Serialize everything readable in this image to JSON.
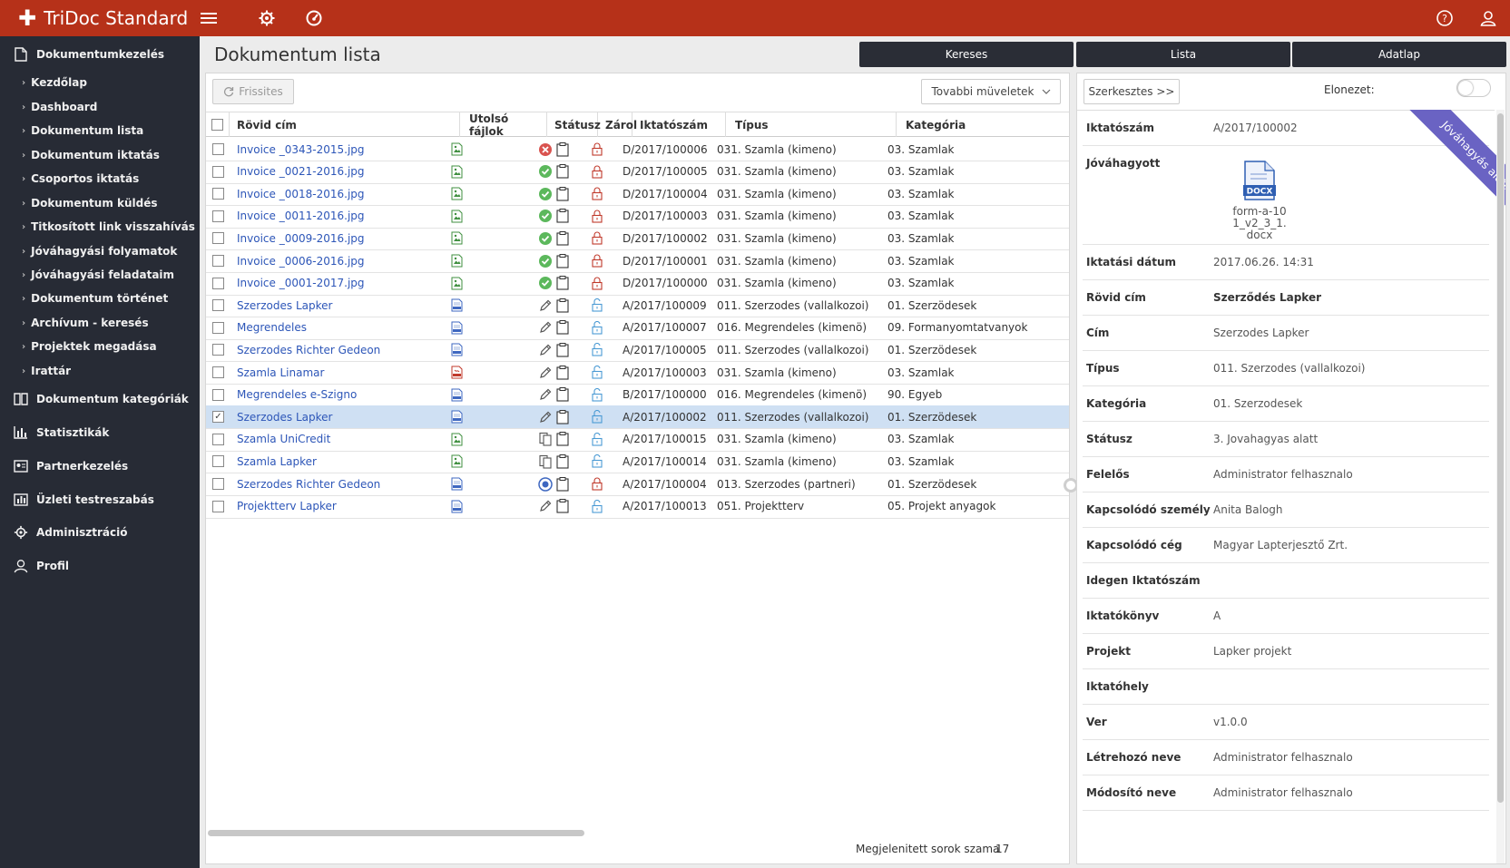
{
  "app": {
    "title": "TriDoc Standard"
  },
  "sidebar": {
    "sections": [
      {
        "label": "Dokumentumkezelés",
        "icon": "document-icon"
      },
      {
        "label": "Dokumentum kategóriák",
        "icon": "book-icon"
      },
      {
        "label": "Statisztikák",
        "icon": "bar-chart-icon"
      },
      {
        "label": "Partnerkezelés",
        "icon": "contact-card-icon"
      },
      {
        "label": "Üzleti testreszabás",
        "icon": "chart-settings-icon"
      },
      {
        "label": "Adminisztráció",
        "icon": "gear-icon"
      },
      {
        "label": "Profil",
        "icon": "user-icon"
      }
    ],
    "items": [
      "Kezdőlap",
      "Dashboard",
      "Dokumentum lista",
      "Dokumentum iktatás",
      "Csoportos iktatás",
      "Dokumentum küldés",
      "Titkosított link visszahívás",
      "Jóváhagyási folyamatok",
      "Jóváhagyási feladataim",
      "Dokumentum történet",
      "Archívum - keresés",
      "Projektek megadása",
      "Irattár"
    ]
  },
  "page": {
    "title": "Dokumentum lista"
  },
  "tabs": {
    "search": "Kereses",
    "list": "Lista",
    "datasheet": "Adatlap"
  },
  "toolbar": {
    "refresh": "Frissites",
    "more": "Tovabbi müveletek"
  },
  "table": {
    "headers": {
      "short_title": "Rövid cím",
      "last_files": "Utolsó fájlok",
      "status": "Státusz",
      "lock": "Zárol",
      "reg_no": "Iktatószám",
      "type": "Típus",
      "category": "Kategória"
    },
    "rows": [
      {
        "title": "Invoice _0343-2015.jpg",
        "file": "image",
        "status": "rejected",
        "locked": true,
        "reg_no": "D/2017/100006",
        "type": "031. Szamla (kimeno)",
        "category": "03. Szamlak",
        "checked": false
      },
      {
        "title": "Invoice _0021-2016.jpg",
        "file": "image",
        "status": "approved",
        "locked": true,
        "reg_no": "D/2017/100005",
        "type": "031. Szamla (kimeno)",
        "category": "03. Szamlak",
        "checked": false
      },
      {
        "title": "Invoice _0018-2016.jpg",
        "file": "image",
        "status": "approved",
        "locked": true,
        "reg_no": "D/2017/100004",
        "type": "031. Szamla (kimeno)",
        "category": "03. Szamlak",
        "checked": false
      },
      {
        "title": "Invoice _0011-2016.jpg",
        "file": "image",
        "status": "approved",
        "locked": true,
        "reg_no": "D/2017/100003",
        "type": "031. Szamla (kimeno)",
        "category": "03. Szamlak",
        "checked": false
      },
      {
        "title": "Invoice _0009-2016.jpg",
        "file": "image",
        "status": "approved",
        "locked": true,
        "reg_no": "D/2017/100002",
        "type": "031. Szamla (kimeno)",
        "category": "03. Szamlak",
        "checked": false
      },
      {
        "title": "Invoice _0006-2016.jpg",
        "file": "image",
        "status": "approved",
        "locked": true,
        "reg_no": "D/2017/100001",
        "type": "031. Szamla (kimeno)",
        "category": "03. Szamlak",
        "checked": false
      },
      {
        "title": "Invoice _0001-2017.jpg",
        "file": "image",
        "status": "approved",
        "locked": true,
        "reg_no": "D/2017/100000",
        "type": "031. Szamla (kimeno)",
        "category": "03. Szamlak",
        "checked": false
      },
      {
        "title": "Szerzodes Lapker",
        "file": "doc",
        "status": "edit",
        "locked": false,
        "reg_no": "A/2017/100009",
        "type": "011. Szerzodes (vallalkozoi)",
        "category": "01. Szerzödesek",
        "checked": false
      },
      {
        "title": "Megrendeles",
        "file": "doc",
        "status": "edit",
        "locked": false,
        "reg_no": "A/2017/100007",
        "type": "016. Megrendeles (kimenö)",
        "category": "09. Formanyomtatvanyok",
        "checked": false
      },
      {
        "title": "Szerzodes Richter Gedeon",
        "file": "doc",
        "status": "edit",
        "locked": false,
        "reg_no": "A/2017/100005",
        "type": "011. Szerzodes (vallalkozoi)",
        "category": "01. Szerzödesek",
        "checked": false
      },
      {
        "title": "Szamla Linamar",
        "file": "pdf",
        "status": "edit",
        "locked": false,
        "reg_no": "A/2017/100003",
        "type": "031. Szamla (kimeno)",
        "category": "03. Szamlak",
        "checked": false
      },
      {
        "title": "Megrendeles e-Szigno",
        "file": "doc",
        "status": "edit",
        "locked": false,
        "reg_no": "B/2017/100000",
        "type": "016. Megrendeles (kimenö)",
        "category": "90. Egyeb",
        "checked": false
      },
      {
        "title": "Szerzodes Lapker",
        "file": "doc",
        "status": "edit",
        "locked": false,
        "reg_no": "A/2017/100002",
        "type": "011. Szerzodes (vallalkozoi)",
        "category": "01. Szerzödesek",
        "checked": true
      },
      {
        "title": "Szamla UniCredit",
        "file": "image",
        "status": "copies",
        "locked": false,
        "reg_no": "A/2017/100015",
        "type": "031. Szamla (kimeno)",
        "category": "03. Szamlak",
        "checked": false
      },
      {
        "title": "Szamla Lapker",
        "file": "image",
        "status": "copies",
        "locked": false,
        "reg_no": "A/2017/100014",
        "type": "031. Szamla (kimeno)",
        "category": "03. Szamlak",
        "checked": false
      },
      {
        "title": "Szerzodes Richter Gedeon",
        "file": "doc",
        "status": "target",
        "locked": true,
        "reg_no": "A/2017/100004",
        "type": "013. Szerzodes (partneri)",
        "category": "01. Szerzödesek",
        "checked": false
      },
      {
        "title": "Projektterv Lapker",
        "file": "doc",
        "status": "edit",
        "locked": false,
        "reg_no": "A/2017/100013",
        "type": "051. Projektterv",
        "category": "05. Projekt anyagok",
        "checked": false
      }
    ]
  },
  "footer": {
    "rows_label": "Megjelenitett sorok szama",
    "rows_count": "17"
  },
  "detail": {
    "edit_button": "Szerkesztes >>",
    "preview_label": "Elonezet:",
    "ribbon": "Jóváhagyás alatt",
    "file": {
      "badge": "DOCX",
      "name": "form-a-101_v2_3_1.docx"
    },
    "fields": [
      {
        "label": "Iktatószám",
        "value": "A/2017/100002"
      },
      {
        "label": "Jóváhagyott",
        "value": ""
      },
      {
        "label": "Iktatási dátum",
        "value": "2017.06.26. 14:31"
      },
      {
        "label": "Rövid cím",
        "value": "Szerződés Lapker",
        "bold": true
      },
      {
        "label": "Cím",
        "value": "Szerzodes Lapker"
      },
      {
        "label": "Típus",
        "value": "011. Szerzodes (vallalkozoi)"
      },
      {
        "label": "Kategória",
        "value": "01. Szerzodesek"
      },
      {
        "label": "Státusz",
        "value": "3. Jovahagyas alatt"
      },
      {
        "label": "Felelős",
        "value": "Administrator felhasznalo"
      },
      {
        "label": "Kapcsolódó személy",
        "value": "Anita Balogh"
      },
      {
        "label": "Kapcsolódó cég",
        "value": "Magyar Lapterjesztő Zrt."
      },
      {
        "label": "Idegen Iktatószám",
        "value": ""
      },
      {
        "label": "Iktatókönyv",
        "value": "A"
      },
      {
        "label": "Projekt",
        "value": "Lapker projekt"
      },
      {
        "label": "Iktatóhely",
        "value": ""
      },
      {
        "label": "Ver",
        "value": "v1.0.0"
      },
      {
        "label": "Létrehozó neve",
        "value": "Administrator felhasznalo"
      },
      {
        "label": "Módosító neve",
        "value": "Administrator felhasznalo"
      }
    ]
  },
  "colors": {
    "brand": "#b63119",
    "sidebar": "#272b35",
    "link": "#2d56b8",
    "ribbon": "#6a63c3",
    "selected_row": "#cfe0f3",
    "approved": "#5cb85c",
    "rejected": "#d9534f"
  }
}
